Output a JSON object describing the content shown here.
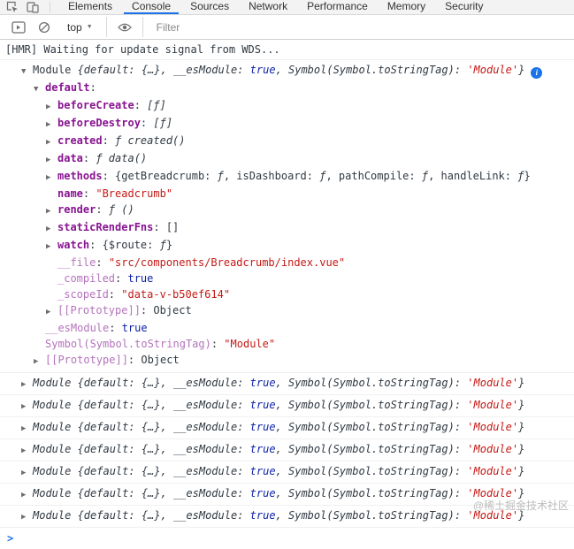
{
  "tabbar": {
    "tabs": [
      "Elements",
      "Console",
      "Sources",
      "Network",
      "Performance",
      "Memory",
      "Security"
    ],
    "active_tab": "Console"
  },
  "toolbar": {
    "context_selector": "top",
    "filter_placeholder": "Filter"
  },
  "icons": {
    "inspect": "inspect-icon",
    "device_toolbar": "device-toolbar-icon",
    "console_sidebar": "console-sidebar-icon",
    "clear_console": "clear-console-icon",
    "live_expression": "eye-icon",
    "caret": "▼",
    "disclosure_open": "▼",
    "disclosure_closed": "▶",
    "info": "i"
  },
  "colors": {
    "accent_blue": "#1a73e8",
    "key_purple": "#881391",
    "faded_key_purple": "#b573bd",
    "string_red": "#c41a16",
    "boolean_blue": "#0d22aa",
    "text": "#303942"
  },
  "console": {
    "prompt_symbol": ">",
    "entries": [
      {
        "type": "log",
        "parts": [
          [
            "plain",
            "[HMR] Waiting for update signal from WDS..."
          ]
        ]
      },
      {
        "type": "object-expanded",
        "rows": [
          {
            "indent": 0,
            "arrow": "open",
            "info": true,
            "parts": [
              [
                "plain",
                "Module "
              ],
              [
                "it",
                "{default: {…}, __esModule: "
              ],
              [
                "itb",
                "true"
              ],
              [
                "it",
                ", Symbol(Symbol.toStringTag): "
              ],
              [
                "itr",
                "'Module'"
              ],
              [
                "it",
                "}"
              ]
            ]
          },
          {
            "indent": 1,
            "arrow": "open",
            "parts": [
              [
                "key",
                "default"
              ],
              [
                "plain",
                ":"
              ]
            ]
          },
          {
            "indent": 2,
            "arrow": "closed",
            "parts": [
              [
                "key",
                "beforeCreate"
              ],
              [
                "plain",
                ": "
              ],
              [
                "fn",
                "[ƒ]"
              ]
            ]
          },
          {
            "indent": 2,
            "arrow": "closed",
            "parts": [
              [
                "key",
                "beforeDestroy"
              ],
              [
                "plain",
                ": "
              ],
              [
                "fn",
                "[ƒ]"
              ]
            ]
          },
          {
            "indent": 2,
            "arrow": "closed",
            "parts": [
              [
                "key",
                "created"
              ],
              [
                "plain",
                ": "
              ],
              [
                "fn",
                "ƒ created()"
              ]
            ]
          },
          {
            "indent": 2,
            "arrow": "closed",
            "parts": [
              [
                "key",
                "data"
              ],
              [
                "plain",
                ": "
              ],
              [
                "fn",
                "ƒ data()"
              ]
            ]
          },
          {
            "indent": 2,
            "arrow": "closed",
            "parts": [
              [
                "key",
                "methods"
              ],
              [
                "plain",
                ": {getBreadcrumb: "
              ],
              [
                "fn",
                "ƒ"
              ],
              [
                "plain",
                ", isDashboard: "
              ],
              [
                "fn",
                "ƒ"
              ],
              [
                "plain",
                ", pathCompile: "
              ],
              [
                "fn",
                "ƒ"
              ],
              [
                "plain",
                ", handleLink: "
              ],
              [
                "fn",
                "ƒ"
              ],
              [
                "plain",
                "}"
              ]
            ]
          },
          {
            "indent": 2,
            "arrow": null,
            "parts": [
              [
                "key",
                "name"
              ],
              [
                "plain",
                ": "
              ],
              [
                "str",
                "\"Breadcrumb\""
              ]
            ]
          },
          {
            "indent": 2,
            "arrow": "closed",
            "parts": [
              [
                "key",
                "render"
              ],
              [
                "plain",
                ": "
              ],
              [
                "fn",
                "ƒ ()"
              ]
            ]
          },
          {
            "indent": 2,
            "arrow": "closed",
            "parts": [
              [
                "key",
                "staticRenderFns"
              ],
              [
                "plain",
                ": []"
              ]
            ]
          },
          {
            "indent": 2,
            "arrow": "closed",
            "parts": [
              [
                "key",
                "watch"
              ],
              [
                "plain",
                ": {$route: "
              ],
              [
                "fn",
                "ƒ"
              ],
              [
                "plain",
                "}"
              ]
            ]
          },
          {
            "indent": 2,
            "arrow": null,
            "parts": [
              [
                "fkey",
                "__file"
              ],
              [
                "plain",
                ": "
              ],
              [
                "str",
                "\"src/components/Breadcrumb/index.vue\""
              ]
            ]
          },
          {
            "indent": 2,
            "arrow": null,
            "parts": [
              [
                "fkey",
                "_compiled"
              ],
              [
                "plain",
                ": "
              ],
              [
                "bool",
                "true"
              ]
            ]
          },
          {
            "indent": 2,
            "arrow": null,
            "parts": [
              [
                "fkey",
                "_scopeId"
              ],
              [
                "plain",
                ": "
              ],
              [
                "str",
                "\"data-v-b50ef614\""
              ]
            ]
          },
          {
            "indent": 2,
            "arrow": "closed",
            "parts": [
              [
                "fkey",
                "[[Prototype]]"
              ],
              [
                "plain",
                ": Object"
              ]
            ]
          },
          {
            "indent": 1,
            "arrow": null,
            "parts": [
              [
                "fkey",
                "__esModule"
              ],
              [
                "plain",
                ": "
              ],
              [
                "bool",
                "true"
              ]
            ]
          },
          {
            "indent": 1,
            "arrow": null,
            "parts": [
              [
                "fkey",
                "Symbol(Symbol.toStringTag)"
              ],
              [
                "plain",
                ": "
              ],
              [
                "str",
                "\"Module\""
              ]
            ]
          },
          {
            "indent": 1,
            "arrow": "closed",
            "parts": [
              [
                "fkey",
                "[[Prototype]]"
              ],
              [
                "plain",
                ": Object"
              ]
            ]
          }
        ]
      },
      {
        "type": "object-collapsed",
        "count": 7,
        "parts": [
          [
            "it",
            "Module {default: {…}, __esModule: "
          ],
          [
            "itb",
            "true"
          ],
          [
            "it",
            ", Symbol(Symbol.toStringTag): "
          ],
          [
            "itr",
            "'Module'"
          ],
          [
            "it",
            "}"
          ]
        ]
      },
      {
        "type": "prompt"
      }
    ]
  },
  "watermark": "@稀土掘金技术社区"
}
